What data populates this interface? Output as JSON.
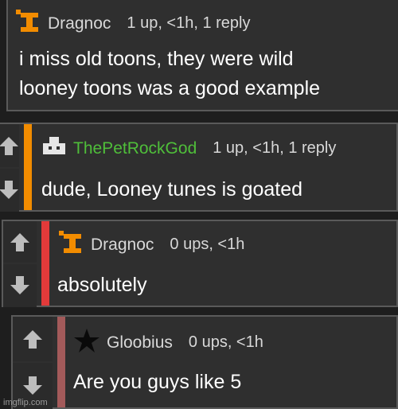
{
  "colors": {
    "background": "#1e1e1e",
    "panel": "#2f2f2f",
    "orange": "#f28c00",
    "red": "#e23a3a",
    "mauve": "#a35a5a",
    "green_user": "#4fbe3a"
  },
  "comments": [
    {
      "username": "Dragnoc",
      "meta": "1 up, <1h, 1 reply",
      "lines": [
        "i miss old toons, they were wild",
        "looney toons was a good example"
      ],
      "avatar_icon": "orange-i-icon"
    },
    {
      "username": "ThePetRockGod",
      "meta": "1 up, <1h, 1 reply",
      "lines": [
        "dude, Looney tunes is goated"
      ],
      "avatar_icon": "pet-rock-icon"
    },
    {
      "username": "Dragnoc",
      "meta": "0 ups, <1h",
      "lines": [
        "absolutely"
      ],
      "avatar_icon": "orange-i-icon"
    },
    {
      "username": "Gloobius",
      "meta": "0 ups, <1h",
      "lines": [
        "Are you guys like 5"
      ],
      "avatar_icon": "black-star-icon"
    }
  ],
  "watermark": "imgflip.com"
}
